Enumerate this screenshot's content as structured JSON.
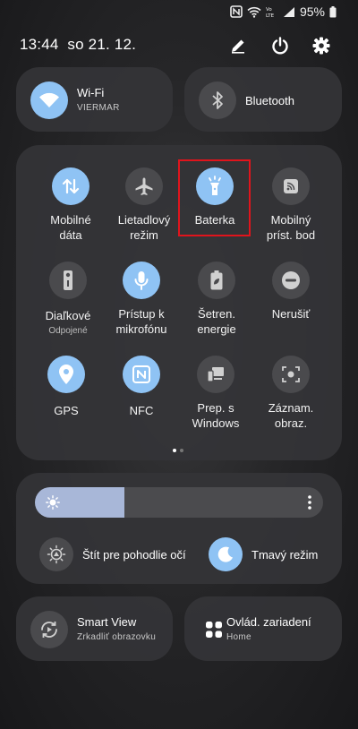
{
  "status": {
    "battery": "95%"
  },
  "header": {
    "time": "13:44",
    "date": "so 21. 12."
  },
  "wifi": {
    "title": "Wi-Fi",
    "network": "VIERMAR"
  },
  "bluetooth": {
    "title": "Bluetooth"
  },
  "tiles": [
    {
      "label": "Mobilné\ndáta",
      "sub": ""
    },
    {
      "label": "Lietadlový\nrežim",
      "sub": ""
    },
    {
      "label": "Baterka",
      "sub": ""
    },
    {
      "label": "Mobilný\npríst. bod",
      "sub": ""
    },
    {
      "label": "Diaľkové",
      "sub": "Odpojené"
    },
    {
      "label": "Prístup k\nmikrofónu",
      "sub": ""
    },
    {
      "label": "Šetren.\nenergie",
      "sub": ""
    },
    {
      "label": "Nerušiť",
      "sub": ""
    },
    {
      "label": "GPS",
      "sub": ""
    },
    {
      "label": "NFC",
      "sub": ""
    },
    {
      "label": "Prep. s\nWindows",
      "sub": ""
    },
    {
      "label": "Záznam.\nobraz.",
      "sub": ""
    }
  ],
  "brightness": {
    "level_percent": 31
  },
  "eye_comfort": {
    "label": "Štít pre pohodlie očí"
  },
  "dark_mode": {
    "label": "Tmavý režim"
  },
  "smart_view": {
    "title": "Smart View",
    "sub": "Zrkadliť obrazovku"
  },
  "devices": {
    "title": "Ovlád. zariadení",
    "sub": "Home"
  },
  "colors": {
    "accent": "#8fc3f4",
    "tile_off": "#4a4a4d",
    "highlight": "#e0141c"
  }
}
